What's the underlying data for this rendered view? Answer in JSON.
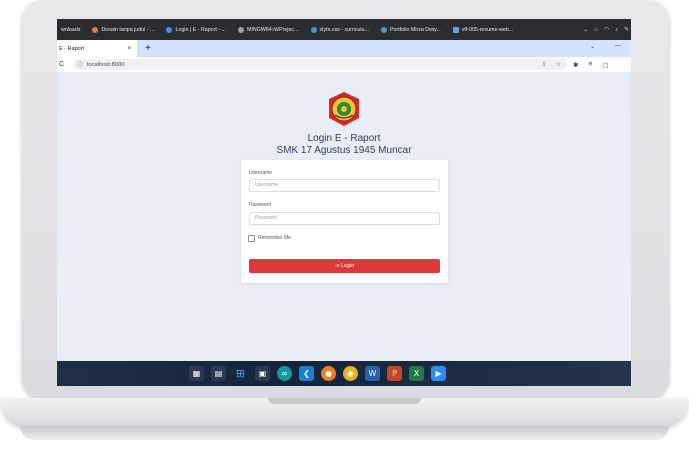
{
  "browser": {
    "bookmarks": [
      {
        "label": "wnloads",
        "color": ""
      },
      {
        "label": "Desain tanpa judul - ...",
        "color": "#e97b2a"
      },
      {
        "label": "Login | E - Raport - ...",
        "color": "#4c8bf5"
      },
      {
        "label": "MINGW64:/d/Projec...",
        "color": "#9aa0a6"
      },
      {
        "label": "style.css - curriculu...",
        "color": "#3b9be0"
      },
      {
        "label": "Portfolio Mirza Dwiy...",
        "color": "#3b9be0"
      },
      {
        "label": "vtf-005-resume-web...",
        "color": "#5aa3e8"
      }
    ],
    "tab_title": "E - Raport",
    "tab_close": "×",
    "new_tab": "+",
    "url": "localhost:8000",
    "reload_glyph": "C",
    "info_glyph": "ⓘ"
  },
  "login": {
    "title": "Login E - Raport",
    "subtitle": "SMK 17 Agustus 1945 Muncar",
    "username_label": "Username",
    "username_placeholder": "Username",
    "password_label": "Password",
    "password_placeholder": "Password",
    "remember_label": "Remember Me",
    "login_button": "Login",
    "login_icon": "sign-in-icon"
  },
  "colors": {
    "accent": "#e0383a",
    "page_bg": "#e9edf5",
    "title_color": "#2f3e63",
    "tab_strip": "#d3e3fd"
  },
  "taskbar": {
    "icons": [
      "task-view-icon",
      "widgets-icon",
      "windows-start-icon",
      "file-explorer-icon",
      "arduino-icon",
      "vscode-icon",
      "firefox-icon",
      "chrome-icon",
      "word-icon",
      "powerpoint-icon",
      "excel-icon",
      "zoom-icon"
    ]
  }
}
